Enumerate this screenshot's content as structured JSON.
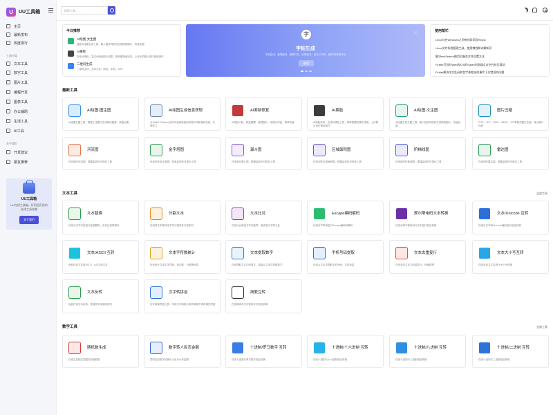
{
  "app": {
    "logo_mark": "U",
    "title": "UU工具箱"
  },
  "sidebar": {
    "items_top": [
      {
        "label": "主页",
        "icon": "home-icon"
      },
      {
        "label": "最新发布",
        "icon": "bell-icon"
      },
      {
        "label": "热度排行",
        "icon": "fire-icon"
      }
    ],
    "group1": "工具分类",
    "categories": [
      {
        "label": "文本工具"
      },
      {
        "label": "数字工具"
      },
      {
        "label": "图片工具"
      },
      {
        "label": "编程开发"
      },
      {
        "label": "图表工具"
      },
      {
        "label": "办公辅助"
      },
      {
        "label": "生活工具"
      },
      {
        "label": "AI工具"
      }
    ],
    "group2": "关于我们",
    "about": [
      {
        "label": "开发建议"
      },
      {
        "label": "朋友推荐"
      }
    ],
    "promo": {
      "title": "UU工具箱",
      "desc": "UU在线工具箱，好用没负担的在线工具合集",
      "button": "关于我们"
    }
  },
  "topbar": {
    "search_placeholder": "搜索工具..."
  },
  "recommend": {
    "title": "今日推荐",
    "items": [
      {
        "name": "AI绘图·文生图",
        "desc": "智能AI绘图生成工具，输入描述词即刻生成精美图片，快速出图",
        "color": "#2bb673"
      },
      {
        "name": "AI换脸",
        "desc": "在线AI换脸，生成AI换脸图片效果，简单便捷地完成，上传你的照片进行换脸操作",
        "color": "#444"
      },
      {
        "name": "二维码生成",
        "desc": "二维码生成，支持文本、网址、手机、WiFi",
        "color": "#3b82f6"
      }
    ]
  },
  "banner": {
    "icon": "字",
    "title": "字帖生成",
    "desc": "字帖生成，钢笔楷书、钢笔行书、毛笔楷书、自定义字体、楷体/宋体等字帖",
    "button": "使用"
  },
  "notices": {
    "title": "使用帮忙",
    "items": [
      "Linux与在Windows之间有何异同及Rsync",
      "Linux文件系统管理工具，使用教程和详解知识",
      "解决sshSearch使用后服务文件设置方法",
      "Flutter打包时Web的iOS的Safari浏览器点击空白处后滚动",
      "Flutter解决中文乱码和包字体相关的事实下方错误的问题"
    ]
  },
  "sections": {
    "latest": {
      "title": "最新工具"
    },
    "text": {
      "title": "文本工具",
      "more": "全部工具"
    },
    "number": {
      "title": "数字工具",
      "more": "全部工具"
    }
  },
  "latest_tools": [
    {
      "name": "AI绘图-图生图",
      "desc": "AI绘图生图工具，根据上传图片生成新的图像，快速出图",
      "color": "#d7ecfd",
      "fg": "#3a8ee8"
    },
    {
      "name": "AI绘图生成信息获取",
      "desc": "从Stable Diffusion或AI作画获取使用的提示词和各种信息，方便学习",
      "color": "#e7edf6",
      "fg": "#6d84a8"
    },
    {
      "name": "AI面部修复",
      "desc": "AI修复人脸，修复模糊、破损图片，老照片修复，简单快速",
      "color": "#c23a3a",
      "fg": "#fff"
    },
    {
      "name": "AI换脸",
      "desc": "AI换脸软件，在线AI换脸工具，简单便捷的操作流程，上传照片进行换脸操作",
      "color": "#3c3c3c",
      "fg": "#fff"
    },
    {
      "name": "AI绘图-文生图",
      "desc": "AI绘图生成文图工具，输入描述词即刻生成精美图片，快速出图",
      "color": "#e6f6ef",
      "fg": "#23a36d"
    },
    {
      "name": "图片压缩",
      "desc": "PNG、JPG、BMP、WEBP、GIF等格式图片压缩，减小图片体积",
      "color": "#e3f1f7",
      "fg": "#1d8fbf"
    },
    {
      "name": "河流图",
      "desc": "在线制作河流图，便捷高效的可视化工具",
      "color": "#fdeae3",
      "fg": "#e8744a"
    },
    {
      "name": "金字塔图",
      "desc": "在线制作金字塔图，简单高效的可视化工具",
      "color": "#e9f5ec",
      "fg": "#2f9b51"
    },
    {
      "name": "漏斗图",
      "desc": "在线制作漏斗图，便捷高效的可视化工具",
      "color": "#f2ecfb",
      "fg": "#8a5cd8"
    },
    {
      "name": "区域面积图",
      "desc": "在线制作区域面积图，便捷高效的可视化工具",
      "color": "#ece9fb",
      "fg": "#5c5ad8"
    },
    {
      "name": "阶梯线图",
      "desc": "在线制作阶梯线图，便捷高效的可视化工具",
      "color": "#ebeafc",
      "fg": "#4e5ee0"
    },
    {
      "name": "雷达图",
      "desc": "在线制作雷达图，便捷高效的可视化工具",
      "color": "#e7f6ec",
      "fg": "#2e9a55"
    }
  ],
  "text_tools": [
    {
      "name": "文本替换",
      "desc": "在线对文本内容进行批量替换，支持正则等操作",
      "color": "#e9f6ea",
      "fg": "#2d9b4e"
    },
    {
      "name": "分割文本",
      "desc": "在线将文本按特定字符分割成多行或多列",
      "color": "#fdf0dc",
      "fg": "#e38b19"
    },
    {
      "name": "文本比对",
      "desc": "在线对比两段文本的差异，高亮显示不同之处",
      "color": "#f3e7f7",
      "fg": "#8e44ad"
    },
    {
      "name": "Escape编码解码",
      "desc": "在线对字符串进行Escape编码和解码",
      "color": "#2bbd6e",
      "fg": "#fff"
    },
    {
      "name": "摩尔斯电码文本转换",
      "desc": "在线对摩尔斯电码与文本进行相互转换",
      "color": "#6b2fa8",
      "fg": "#fff"
    },
    {
      "name": "文本/Unicode 互转",
      "desc": "在线对文本和Unicode编码进行相互转换",
      "color": "#2c6fd8",
      "fg": "#fff"
    },
    {
      "name": "文本/ASCII 互转",
      "desc": "免费在线文本转ASCII，ASCII转文本",
      "color": "#1ec2dd",
      "fg": "#fff"
    },
    {
      "name": "文本字符数统计",
      "desc": "在线统计文本中字符数、单词数、行数等信息",
      "color": "#fdf2dd",
      "fg": "#e3a019"
    },
    {
      "name": "文本提取数字",
      "desc": "在线提取文本中的数字，批量从文本中提取数字",
      "color": "#e8f3fc",
      "fg": "#2d7fd0"
    },
    {
      "name": "手机号码提取",
      "desc": "在线从文本中提取手机号码，支持批量",
      "color": "#e5eefc",
      "fg": "#2d6ad6"
    },
    {
      "name": "文本去重复行",
      "desc": "在线去除文本中的重复行，快速整理",
      "color": "#fde7e5",
      "fg": "#e54a3c"
    },
    {
      "name": "文本大小写互转",
      "desc": "在线对英文文本进行大小写转换",
      "color": "#2aa6e8",
      "fg": "#fff"
    },
    {
      "name": "文本反转",
      "desc": "免费在线文本反转，快速将文本倒序排列",
      "color": "#e8f5e9",
      "fg": "#2f9b4f"
    },
    {
      "name": "汉字转拼音",
      "desc": "汉字转换拼音工具，可将汉字转换为带声调或不带声调的拼音",
      "color": "#e4eefc",
      "fg": "#2f6fd8"
    },
    {
      "name": "简繁互转",
      "desc": "在线简体中文与繁体中文相互转换",
      "color": "#fff",
      "fg": "#333"
    }
  ],
  "number_tools": [
    {
      "name": "随机数生成",
      "desc": "在线生成指定范围内的随机数",
      "color": "#fde7e7",
      "fg": "#d83a3a"
    },
    {
      "name": "数字转人民币金额",
      "desc": "将阿拉伯数字转换为人民币大写金额",
      "color": "#e6eefb",
      "fg": "#2a63c8"
    },
    {
      "name": "十进制/罗马数字 互转",
      "desc": "在线十进制与罗马数字相互转换",
      "color": "#3a7ce8",
      "fg": "#fff"
    },
    {
      "name": "十进制/十六进制 互转",
      "desc": "在线十进制与十六进制相互转换",
      "color": "#27b3e8",
      "fg": "#fff"
    },
    {
      "name": "十进制/八进制 互转",
      "desc": "在线十进制与八进制相互转换",
      "color": "#2f8fe0",
      "fg": "#fff"
    },
    {
      "name": "十进制/二进制 互转",
      "desc": "在线十进制与二进制相互转换",
      "color": "#2c74d8",
      "fg": "#fff"
    }
  ]
}
